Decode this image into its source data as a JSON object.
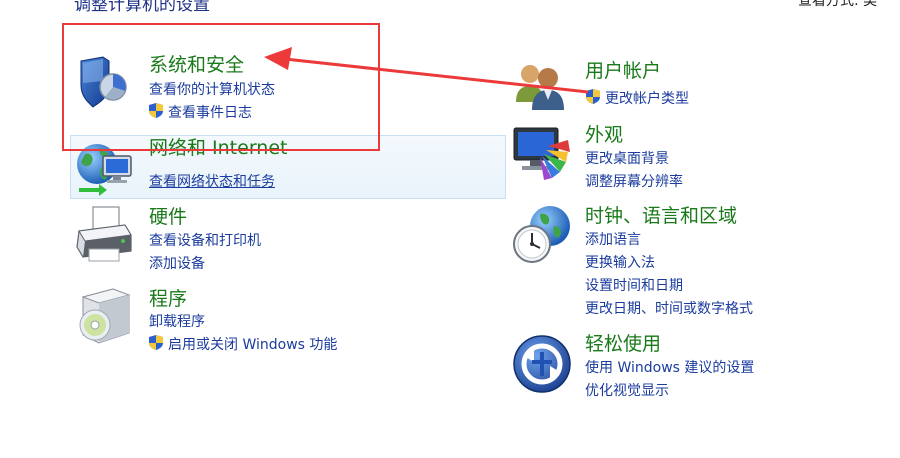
{
  "header": {
    "title": "调整计算机的设置",
    "view_by": "查看方式:  类"
  },
  "left": [
    {
      "title": "系统和安全",
      "links": [
        "查看你的计算机状态",
        "查看事件日志"
      ],
      "icon": "shield-security-icon"
    },
    {
      "title": "网络和 Internet",
      "links": [
        "查看网络状态和任务"
      ],
      "icon": "network-globe-icon"
    },
    {
      "title": "硬件",
      "links": [
        "查看设备和打印机",
        "添加设备"
      ],
      "icon": "printer-icon"
    },
    {
      "title": "程序",
      "links": [
        "卸载程序",
        "启用或关闭 Windows 功能"
      ],
      "icon": "programs-disc-icon"
    }
  ],
  "right": [
    {
      "title": "用户帐户",
      "links": [
        "更改帐户类型"
      ],
      "icon": "users-icon"
    },
    {
      "title": "外观",
      "links": [
        "更改桌面背景",
        "调整屏幕分辨率"
      ],
      "icon": "monitor-appearance-icon"
    },
    {
      "title": "时钟、语言和区域",
      "links": [
        "添加语言",
        "更换输入法",
        "设置时间和日期",
        "更改日期、时间或数字格式"
      ],
      "icon": "clock-globe-icon"
    },
    {
      "title": "轻松使用",
      "links": [
        "使用 Windows 建议的设置",
        "优化视觉显示"
      ],
      "icon": "ease-of-access-icon"
    }
  ],
  "colors": {
    "title_green": "#1a7a1a",
    "link_blue": "#1b3c9e",
    "annotation_red": "#ec3a3a"
  }
}
